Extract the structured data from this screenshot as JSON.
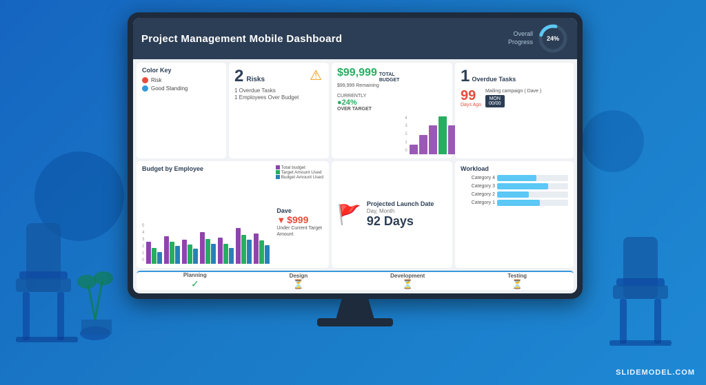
{
  "page": {
    "background_color": "#1a7ac7"
  },
  "header": {
    "title": "Project Management Mobile Dashboard",
    "overall_label": "Overall\nProgress",
    "progress_pct": "24%",
    "progress_value": 24
  },
  "color_key": {
    "title": "Color Key",
    "items": [
      {
        "label": "Risk",
        "color": "#e74c3c"
      },
      {
        "label": "Good Standing",
        "color": "#3498db"
      }
    ]
  },
  "risks": {
    "count": "2",
    "label": "Risks",
    "details": [
      "1  Overdue Tasks",
      "1  Employees Over Budget"
    ]
  },
  "budget": {
    "amount": "$99,999",
    "total_label": "TOTAL BUDGET",
    "remaining": "$99,999 Remaining",
    "currently_label": "CURRENTLY",
    "currently_pct": "●24%",
    "over_label": "OVER TARGET",
    "chart_values": [
      1,
      2,
      3,
      4,
      3
    ],
    "axis_labels": [
      "4",
      "3",
      "2",
      "1",
      "0"
    ]
  },
  "overdue_tasks": {
    "count": "1",
    "label": "Overdue Tasks",
    "days_ago": "99",
    "days_label": "Days Ago",
    "campaign": "Mailing campaign ( Dave )",
    "badge": "MON\n00/00"
  },
  "budget_by_employee": {
    "title": "Budget by Employee",
    "legend": [
      {
        "label": "Total budget",
        "color": "#8e44ad"
      },
      {
        "label": "Target Amount Used",
        "color": "#27ae60"
      },
      {
        "label": "Budget Amount Used",
        "color": "#2980b9"
      }
    ],
    "axis_labels": [
      "5",
      "4",
      "3",
      "2",
      "1",
      "0"
    ],
    "groups": [
      {
        "bars": [
          55,
          40,
          30
        ]
      },
      {
        "bars": [
          70,
          55,
          45
        ]
      },
      {
        "bars": [
          60,
          48,
          38
        ]
      },
      {
        "bars": [
          80,
          62,
          50
        ]
      },
      {
        "bars": [
          65,
          50,
          40
        ]
      },
      {
        "bars": [
          90,
          72,
          60
        ]
      },
      {
        "bars": [
          75,
          58,
          46
        ]
      }
    ],
    "dave_name": "Dave",
    "dave_amount": "$999",
    "dave_under": "Under Current\nTarget Amount"
  },
  "launch": {
    "title": "Projected\nLaunch Date",
    "date_label": "Day, Month",
    "days": "92 Days"
  },
  "workload": {
    "title": "Workload",
    "categories": [
      {
        "label": "Category 4",
        "pct": 55
      },
      {
        "label": "Category 3",
        "pct": 72
      },
      {
        "label": "Category 2",
        "pct": 45
      },
      {
        "label": "Category 1",
        "pct": 60
      }
    ]
  },
  "phases": [
    {
      "name": "Planning",
      "status": "done"
    },
    {
      "name": "Design",
      "status": "pending"
    },
    {
      "name": "Development",
      "status": "pending"
    },
    {
      "name": "Testing",
      "status": "pending"
    }
  ],
  "watermark": "SLIDEMODEL.COM"
}
